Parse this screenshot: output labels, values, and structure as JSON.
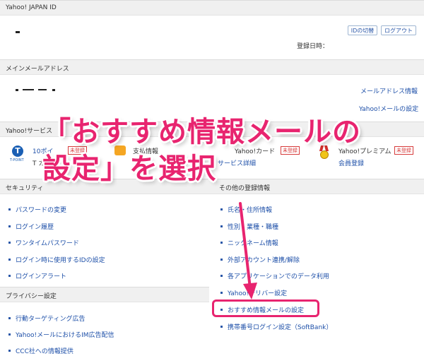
{
  "yahoo_id": {
    "header": "Yahoo! JAPAN ID",
    "switch_id_button": "IDの切替",
    "logout_button": "ログアウト",
    "registered_date_label": "登録日時："
  },
  "main_mail": {
    "header": "メインメールアドレス",
    "mail_info_link": "メールアドレス情報",
    "yahoo_mail_settings_link": "Yahoo!メールの設定"
  },
  "services": {
    "header": "Yahoo!サービス",
    "tpoint_logo": "T-POINT",
    "tpoint_points": "10ポイ",
    "tpoint_sub": "T カ",
    "unregistered_badge": "未登録",
    "payment_label": "支払",
    "payment_suffix": "情報",
    "yahoo_card_label": "Yahoo!カード",
    "yahoo_card_badge": "未登録",
    "card_service_link": "サービス詳細",
    "premium_label": "Yahoo!プレミアム",
    "premium_badge": "未登録",
    "premium_register_link": "会員登録"
  },
  "security": {
    "header": "セキュリティ",
    "items": [
      "パスワードの変更",
      "ログイン履歴",
      "ワンタイムパスワード",
      "ログイン時に使用するIDの設定",
      "ログインアラート"
    ]
  },
  "other_info": {
    "header_suffix": "その他の登録情報",
    "items": [
      "氏名・住所情報",
      "性別・業種・職種",
      "ニックネーム情報",
      "外部アカウント連携/解除",
      "各アプリケーションでのデータ利用",
      "Yahoo!デリバー設定",
      "おすすめ情報メールの設定",
      "携帯番号ログイン設定（SoftBank）"
    ]
  },
  "privacy": {
    "header": "プライバシー設定",
    "items": [
      "行動ターゲティング広告",
      "Yahoo!メールにおけるIM広告配信",
      "CCC社への情報提供"
    ]
  },
  "overlay": {
    "line1": "「おすすめ情報メールの",
    "line2": "設定」を選択",
    "highlight_color": "#e8246f"
  }
}
